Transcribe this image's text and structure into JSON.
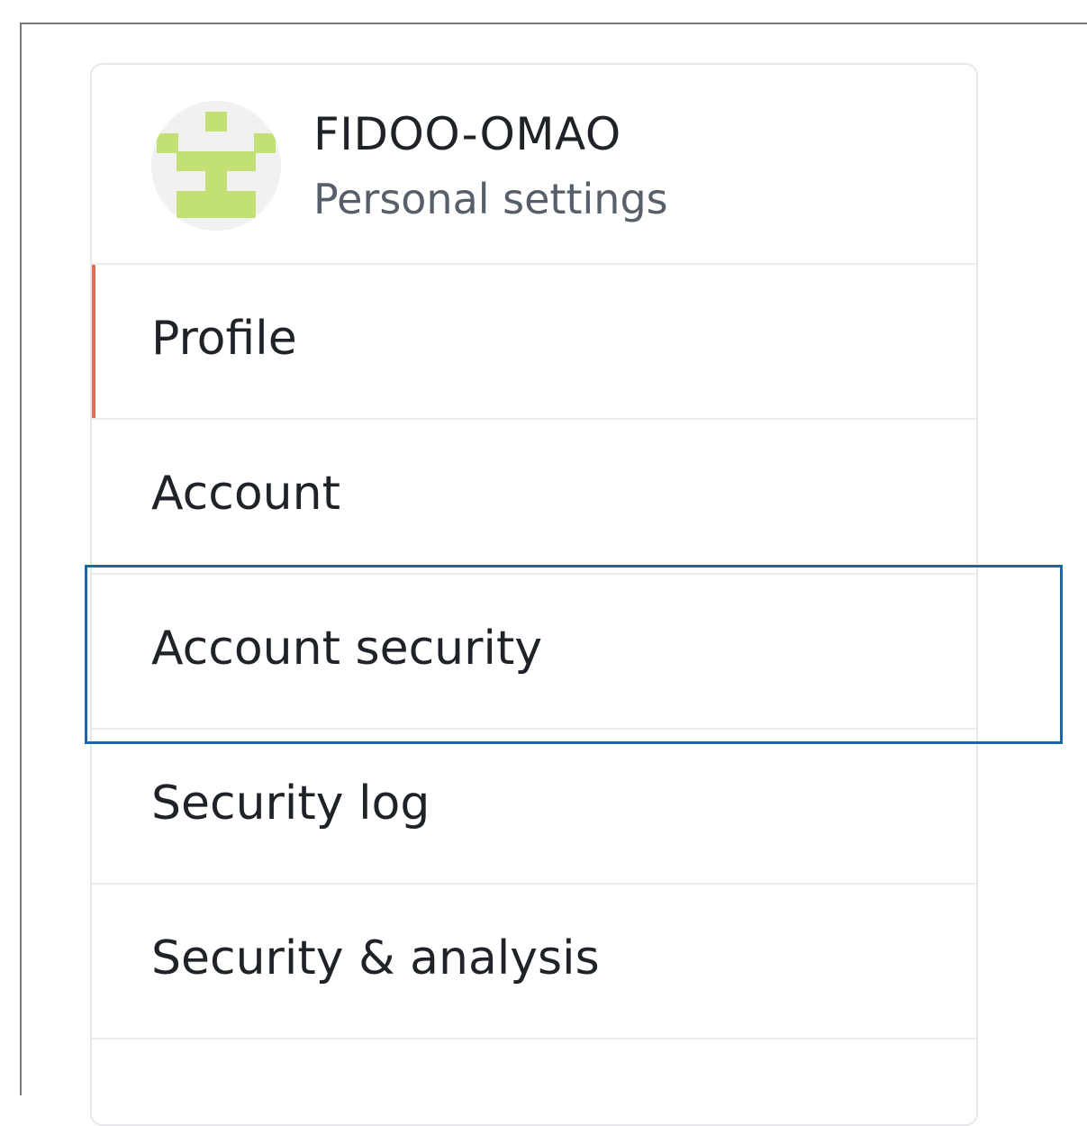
{
  "header": {
    "title": "FIDOO-OMAO",
    "subtitle": "Personal settings"
  },
  "menu": {
    "items": [
      {
        "label": "Profile",
        "selected": true
      },
      {
        "label": "Account",
        "selected": false
      },
      {
        "label": "Account security",
        "selected": false,
        "focused": true
      },
      {
        "label": "Security log",
        "selected": false
      },
      {
        "label": "Security & analysis",
        "selected": false
      }
    ]
  },
  "colors": {
    "selected_indicator": "#e46c55",
    "focus_outline": "#1668b3",
    "avatar_pattern": "#c3e074",
    "divider": "#e9ebee"
  }
}
